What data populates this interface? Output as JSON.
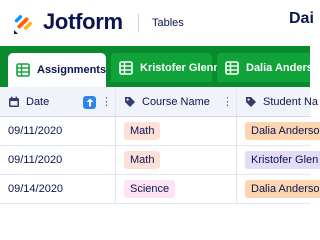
{
  "header": {
    "brand": "Jotform",
    "product": "Tables",
    "doc_title": "Dai"
  },
  "tabs": [
    {
      "label": "Assignments",
      "active": true,
      "icon": "table-icon"
    },
    {
      "label": "Kristofer Glenn",
      "active": false,
      "icon": "table-icon"
    },
    {
      "label": "Dalia Anderson",
      "active": false,
      "icon": "table-icon"
    }
  ],
  "columns": {
    "date": "Date",
    "course": "Course Name",
    "student": "Student Na"
  },
  "rows": [
    {
      "date": "09/11/2020",
      "course": "Math",
      "student": "Dalia Anderso"
    },
    {
      "date": "09/11/2020",
      "course": "Math",
      "student": "Kristofer Glen"
    },
    {
      "date": "09/14/2020",
      "course": "Science",
      "student": "Dalia Anderso"
    }
  ],
  "colors": {
    "header_green": "#0a8a2f",
    "tab_green": "#0fa33a",
    "pill_math": "#fde1d8",
    "pill_science": "#fde3f3",
    "pill_dalia": "#fdd5b0",
    "pill_kristofer": "#e4dcf6",
    "sort_blue": "#2e86e8"
  }
}
